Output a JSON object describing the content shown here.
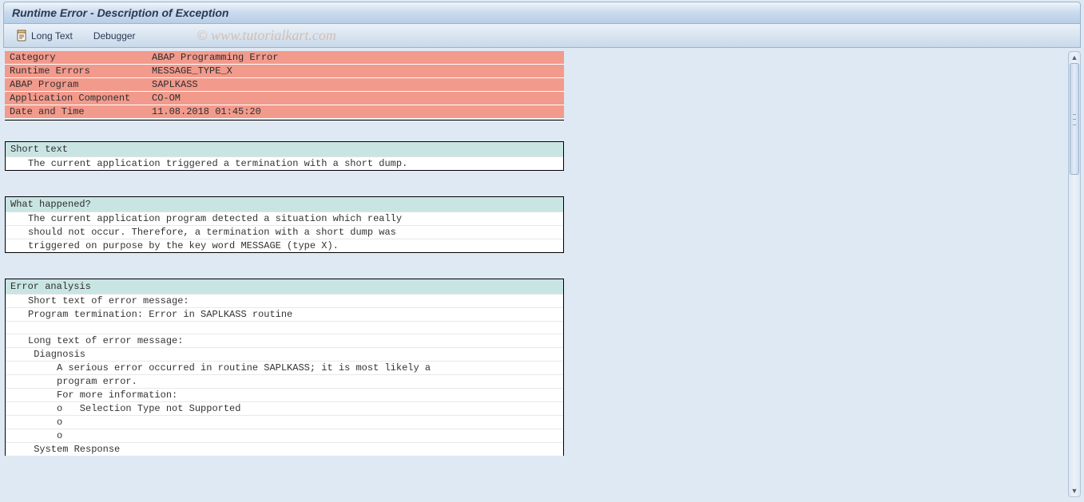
{
  "title": "Runtime Error - Description of Exception",
  "toolbar": {
    "long_text": "Long Text",
    "debugger": "Debugger"
  },
  "watermark": "© www.tutorialkart.com",
  "info": [
    {
      "label": "Category",
      "value": "ABAP Programming Error"
    },
    {
      "label": "Runtime Errors",
      "value": "MESSAGE_TYPE_X"
    },
    {
      "label": "ABAP Program",
      "value": "SAPLKASS"
    },
    {
      "label": "Application Component",
      "value": "CO-OM"
    },
    {
      "label": "Date and Time",
      "value": "11.08.2018 01:45:20"
    }
  ],
  "sections": {
    "short_text": {
      "heading": "Short text",
      "lines": [
        "The current application triggered a termination with a short dump."
      ]
    },
    "what_happened": {
      "heading": "What happened?",
      "lines": [
        "The current application program detected a situation which really",
        "should not occur. Therefore, a termination with a short dump was",
        "triggered on purpose by the key word MESSAGE (type X)."
      ]
    },
    "error_analysis": {
      "heading": "Error analysis",
      "lines": [
        "Short text of error message:",
        "Program termination: Error in SAPLKASS routine",
        "",
        "Long text of error message:",
        " Diagnosis",
        "     A serious error occurred in routine SAPLKASS; it is most likely a",
        "     program error.",
        "     For more information:",
        "     o   Selection Type not Supported",
        "     o",
        "     o",
        " System Response"
      ]
    }
  }
}
